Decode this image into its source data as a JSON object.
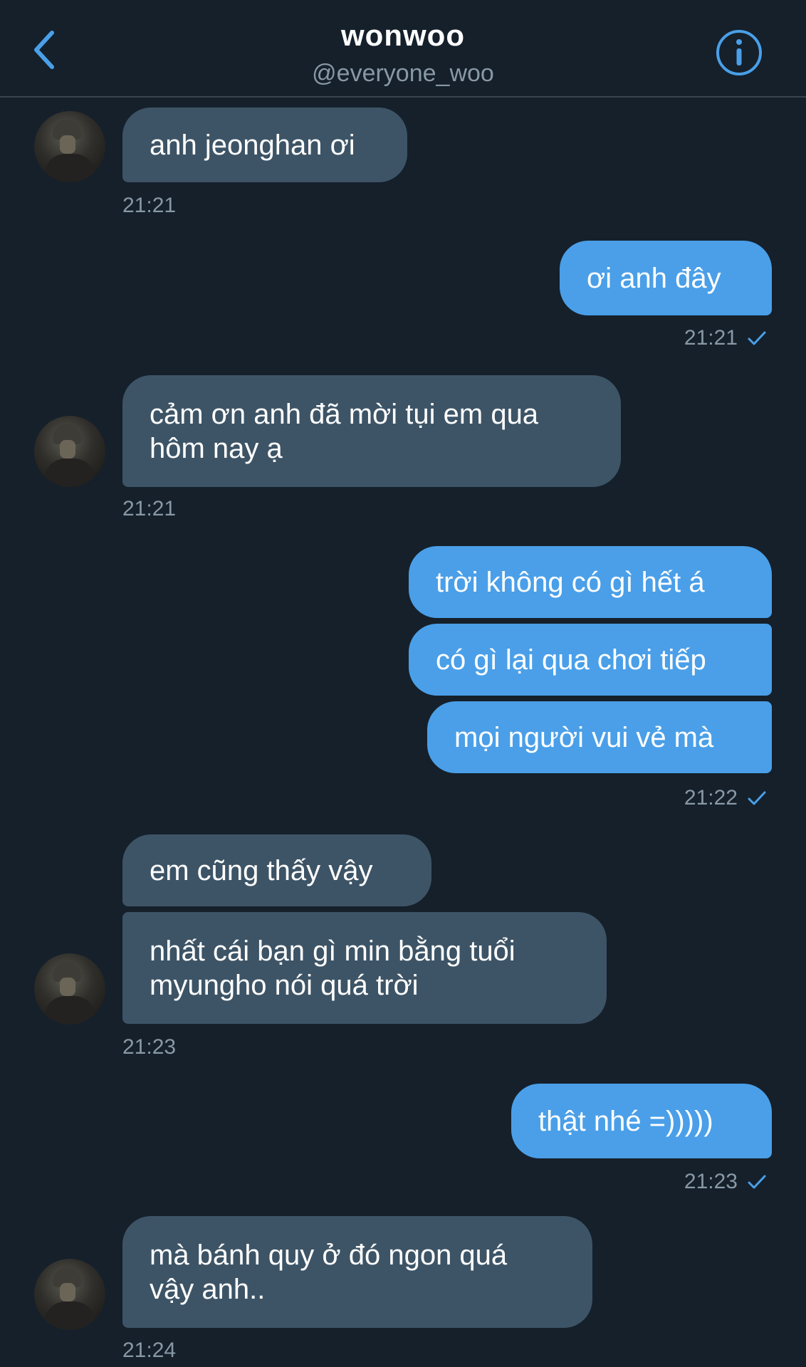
{
  "header": {
    "title": "wonwoo",
    "handle": "@everyone_woo"
  },
  "messages": [
    {
      "text": "anh jeonghan ơi"
    },
    {
      "time": "21:21"
    },
    {
      "text": "ơi anh đây"
    },
    {
      "time": "21:21"
    },
    {
      "text": "cảm ơn anh đã mời tụi em qua\nhôm nay ạ"
    },
    {
      "time": "21:21"
    },
    {
      "text": "trời không có gì hết á"
    },
    {
      "text": "có gì lại qua chơi tiếp"
    },
    {
      "text": "mọi người vui vẻ mà"
    },
    {
      "time": "21:22"
    },
    {
      "text": "em cũng thấy vậy"
    },
    {
      "text": "nhất cái bạn gì min bằng tuổi\nmyungho nói quá trời"
    },
    {
      "time": "21:23"
    },
    {
      "text": "thật nhé =)))))"
    },
    {
      "time": "21:23"
    },
    {
      "text": "mà bánh quy ở đó ngon quá\nvậy anh.."
    },
    {
      "time": "21:24"
    }
  ],
  "colors": {
    "background": "#15202b",
    "incoming_bubble": "#3d5466",
    "outgoing_bubble": "#4a9fe8",
    "accent": "#4a9fe8",
    "muted_text": "#8899a6"
  }
}
